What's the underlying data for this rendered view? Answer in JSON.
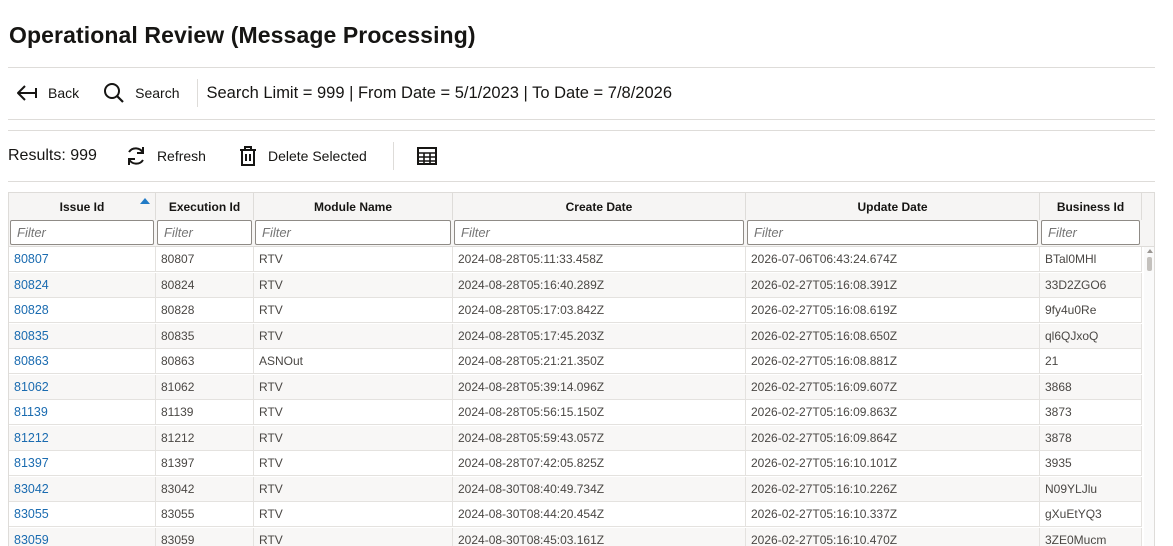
{
  "page": {
    "title": "Operational Review (Message Processing)"
  },
  "toolbar": {
    "back_label": "Back",
    "search_label": "Search",
    "search_summary": "Search Limit = 999 | From Date = 5/1/2023 | To Date = 7/8/2026",
    "results_label": "Results: 999",
    "refresh_label": "Refresh",
    "delete_label": "Delete Selected",
    "icons": {
      "back": "back-arrow-icon",
      "search": "search-icon",
      "refresh": "refresh-icon",
      "delete": "trash-icon",
      "columns": "table-columns-icon"
    }
  },
  "colors": {
    "accent": "#227bc6",
    "link": "#1a6bb0",
    "border": "#dedcd9"
  },
  "table": {
    "sorted_column": "Issue Id",
    "sort_direction": "ascending",
    "filter_placeholder": "Filter",
    "columns": [
      "Issue Id",
      "Execution Id",
      "Module Name",
      "Create Date",
      "Update Date",
      "Business Id"
    ],
    "rows": [
      [
        "80807",
        "80807",
        "RTV",
        "2024-08-28T05:11:33.458Z",
        "2026-07-06T06:43:24.674Z",
        "BTal0MHl"
      ],
      [
        "80824",
        "80824",
        "RTV",
        "2024-08-28T05:16:40.289Z",
        "2026-02-27T05:16:08.391Z",
        "33D2ZGO6"
      ],
      [
        "80828",
        "80828",
        "RTV",
        "2024-08-28T05:17:03.842Z",
        "2026-02-27T05:16:08.619Z",
        "9fy4u0Re"
      ],
      [
        "80835",
        "80835",
        "RTV",
        "2024-08-28T05:17:45.203Z",
        "2026-02-27T05:16:08.650Z",
        "ql6QJxoQ"
      ],
      [
        "80863",
        "80863",
        "ASNOut",
        "2024-08-28T05:21:21.350Z",
        "2026-02-27T05:16:08.881Z",
        "21"
      ],
      [
        "81062",
        "81062",
        "RTV",
        "2024-08-28T05:39:14.096Z",
        "2026-02-27T05:16:09.607Z",
        "3868"
      ],
      [
        "81139",
        "81139",
        "RTV",
        "2024-08-28T05:56:15.150Z",
        "2026-02-27T05:16:09.863Z",
        "3873"
      ],
      [
        "81212",
        "81212",
        "RTV",
        "2024-08-28T05:59:43.057Z",
        "2026-02-27T05:16:09.864Z",
        "3878"
      ],
      [
        "81397",
        "81397",
        "RTV",
        "2024-08-28T07:42:05.825Z",
        "2026-02-27T05:16:10.101Z",
        "3935"
      ],
      [
        "83042",
        "83042",
        "RTV",
        "2024-08-30T08:40:49.734Z",
        "2026-02-27T05:16:10.226Z",
        "N09YLJlu"
      ],
      [
        "83055",
        "83055",
        "RTV",
        "2024-08-30T08:44:20.454Z",
        "2026-02-27T05:16:10.337Z",
        "gXuEtYQ3"
      ],
      [
        "83059",
        "83059",
        "RTV",
        "2024-08-30T08:45:03.161Z",
        "2026-02-27T05:16:10.470Z",
        "3ZE0Mucm"
      ]
    ]
  }
}
